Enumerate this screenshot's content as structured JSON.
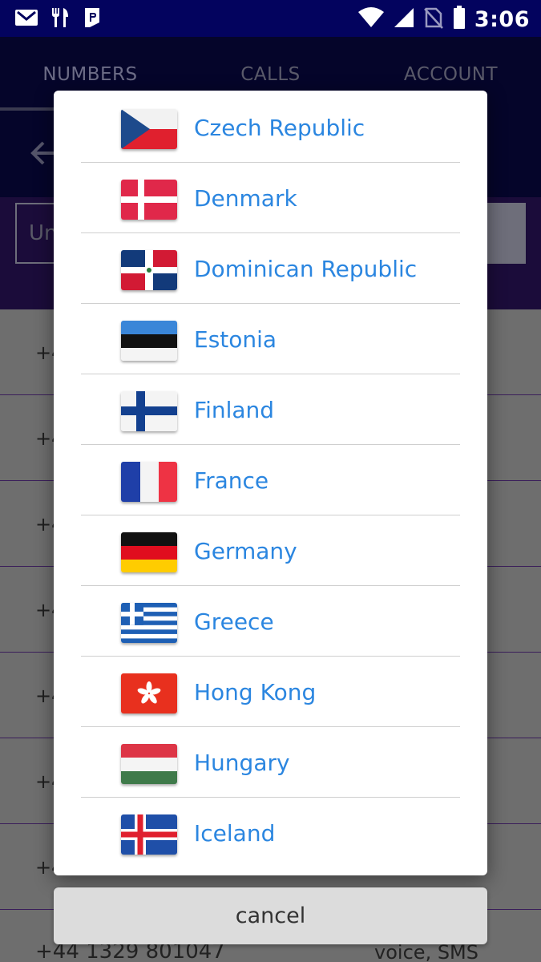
{
  "status_bar": {
    "time": "3:06",
    "icons": [
      "gmail-icon",
      "restaurant-icon",
      "parking-app-icon",
      "wifi-icon",
      "signal-icon",
      "no-sim-icon",
      "battery-icon"
    ]
  },
  "tabs": [
    {
      "label": "NUMBERS"
    },
    {
      "label": "CALLS"
    },
    {
      "label": "ACCOUNT"
    }
  ],
  "filter": {
    "partial_text": "Un"
  },
  "bottom_row": {
    "number": "+44 1329 801047",
    "type": "voice, SMS"
  },
  "background_rows": [
    "+4",
    "+4",
    "+4",
    "+4",
    "+4",
    "+4",
    "+4"
  ],
  "dialog": {
    "countries": [
      {
        "name": "Czech Republic",
        "flag": "czech-republic"
      },
      {
        "name": "Denmark",
        "flag": "denmark"
      },
      {
        "name": "Dominican Republic",
        "flag": "dominican-republic"
      },
      {
        "name": "Estonia",
        "flag": "estonia"
      },
      {
        "name": "Finland",
        "flag": "finland"
      },
      {
        "name": "France",
        "flag": "france"
      },
      {
        "name": "Germany",
        "flag": "germany"
      },
      {
        "name": "Greece",
        "flag": "greece"
      },
      {
        "name": "Hong Kong",
        "flag": "hong-kong"
      },
      {
        "name": "Hungary",
        "flag": "hungary"
      },
      {
        "name": "Iceland",
        "flag": "iceland"
      }
    ],
    "cancel_label": "cancel"
  },
  "colors": {
    "status_bar": "#03035e",
    "country_text": "#2b86e0",
    "divider": "#cfcfcf",
    "cancel_bg": "#dcdcdc"
  }
}
